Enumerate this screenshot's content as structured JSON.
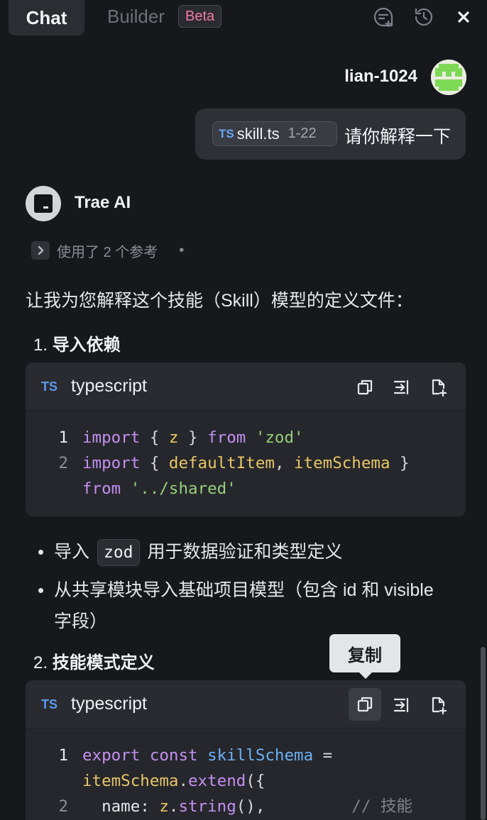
{
  "tabs": {
    "chat": "Chat",
    "builder": "Builder",
    "beta": "Beta"
  },
  "toolbar_icons": [
    "new-chat-icon",
    "history-icon",
    "close-icon"
  ],
  "user_message": {
    "name": "lian-1024",
    "file_chip": {
      "lang": "TS",
      "file": "skill.ts",
      "range": "1-22"
    },
    "text": "请你解释一下"
  },
  "assistant": {
    "name": "Trae AI",
    "refs_label": "使用了 2 个参考",
    "refs_dot": "•",
    "intro": "让我为您解释这个技能（Skill）模型的定义文件：",
    "section1": {
      "num": "1.",
      "title": "导入依赖"
    },
    "code1": {
      "lang_icon": "TS",
      "lang": "typescript",
      "line_numbers": [
        "1",
        "2"
      ]
    },
    "bullets": {
      "b1_pre": "导入",
      "b1_code": "zod",
      "b1_post": "用于数据验证和类型定义",
      "b2_line1": "从共享模块导入基础项目模型（包含 id 和 visible",
      "b2_line2": "字段）"
    },
    "section2": {
      "num": "2.",
      "title": "技能模式定义"
    },
    "tooltip": "复制",
    "code2": {
      "lang_icon": "TS",
      "lang": "typescript",
      "line_numbers": [
        "1",
        "2"
      ]
    }
  },
  "code_tool_icons": [
    "copy-icon",
    "insert-icon",
    "new-file-icon"
  ]
}
